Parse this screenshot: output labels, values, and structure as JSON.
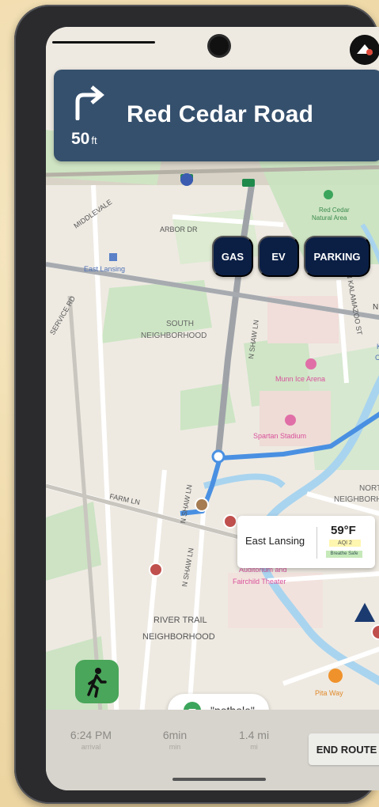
{
  "navigation": {
    "distance_value": "50",
    "distance_unit": "ft",
    "street_name": "Red Cedar Road",
    "maneuver": "turn-right-icon"
  },
  "quick_filters": [
    {
      "label": "GAS"
    },
    {
      "label": "EV"
    },
    {
      "label": "PARKING"
    }
  ],
  "map_labels": {
    "east_lansing_station": "East Lansing",
    "arbor_dr": "ARBOR DR",
    "middlevale": "MIDDLEVALE",
    "service_rd": "SERVICE RD",
    "south_neighborhood_1": "SOUTH",
    "south_neighborhood_2": "NEIGHBORHOOD",
    "shaw_ln_north": "N SHAW LN",
    "farm_ln": "FARM LN",
    "n_shaw_ln_a": "N SHAW LN",
    "n_shaw_ln_b": "N SHAW LN",
    "red_cedar_area_1": "Red Cedar",
    "red_cedar_area_2": "Natural Area",
    "kalamazoo": "N KALAMAZOO ST",
    "munn_arena": "Munn Ice Arena",
    "spartan_stadium": "Spartan Stadium",
    "north_neighborhood_1": "NORTH",
    "north_neighborhood_2": "NEIGHBORH",
    "auditorium_1": "Auditorium and",
    "auditorium_2": "Fairchild Theater",
    "river_trail_1": "RIVER TRAIL",
    "river_trail_2": "NEIGHBORHOOD",
    "pita_way": "Pita Way",
    "ne_partial": "NE",
    "ko_partial": "Ko",
    "co_partial": "Co"
  },
  "weather": {
    "city": "East Lansing",
    "temperature": "59°F",
    "aqi": "AQI 2",
    "aqi_status": "Breathe Safe"
  },
  "voice_report": {
    "text": "\"pothole\""
  },
  "trip": {
    "arrival_time": "6:24 PM",
    "arrival_label": "arrival",
    "duration": "6min",
    "duration_label": "min",
    "distance": "1.4 mi",
    "distance_label": "mi",
    "end_label": "END ROUTE"
  },
  "colors": {
    "banner": "#35506d",
    "chip": "#0b1f45",
    "route": "#4a90e2",
    "report": "#4aa65a"
  }
}
